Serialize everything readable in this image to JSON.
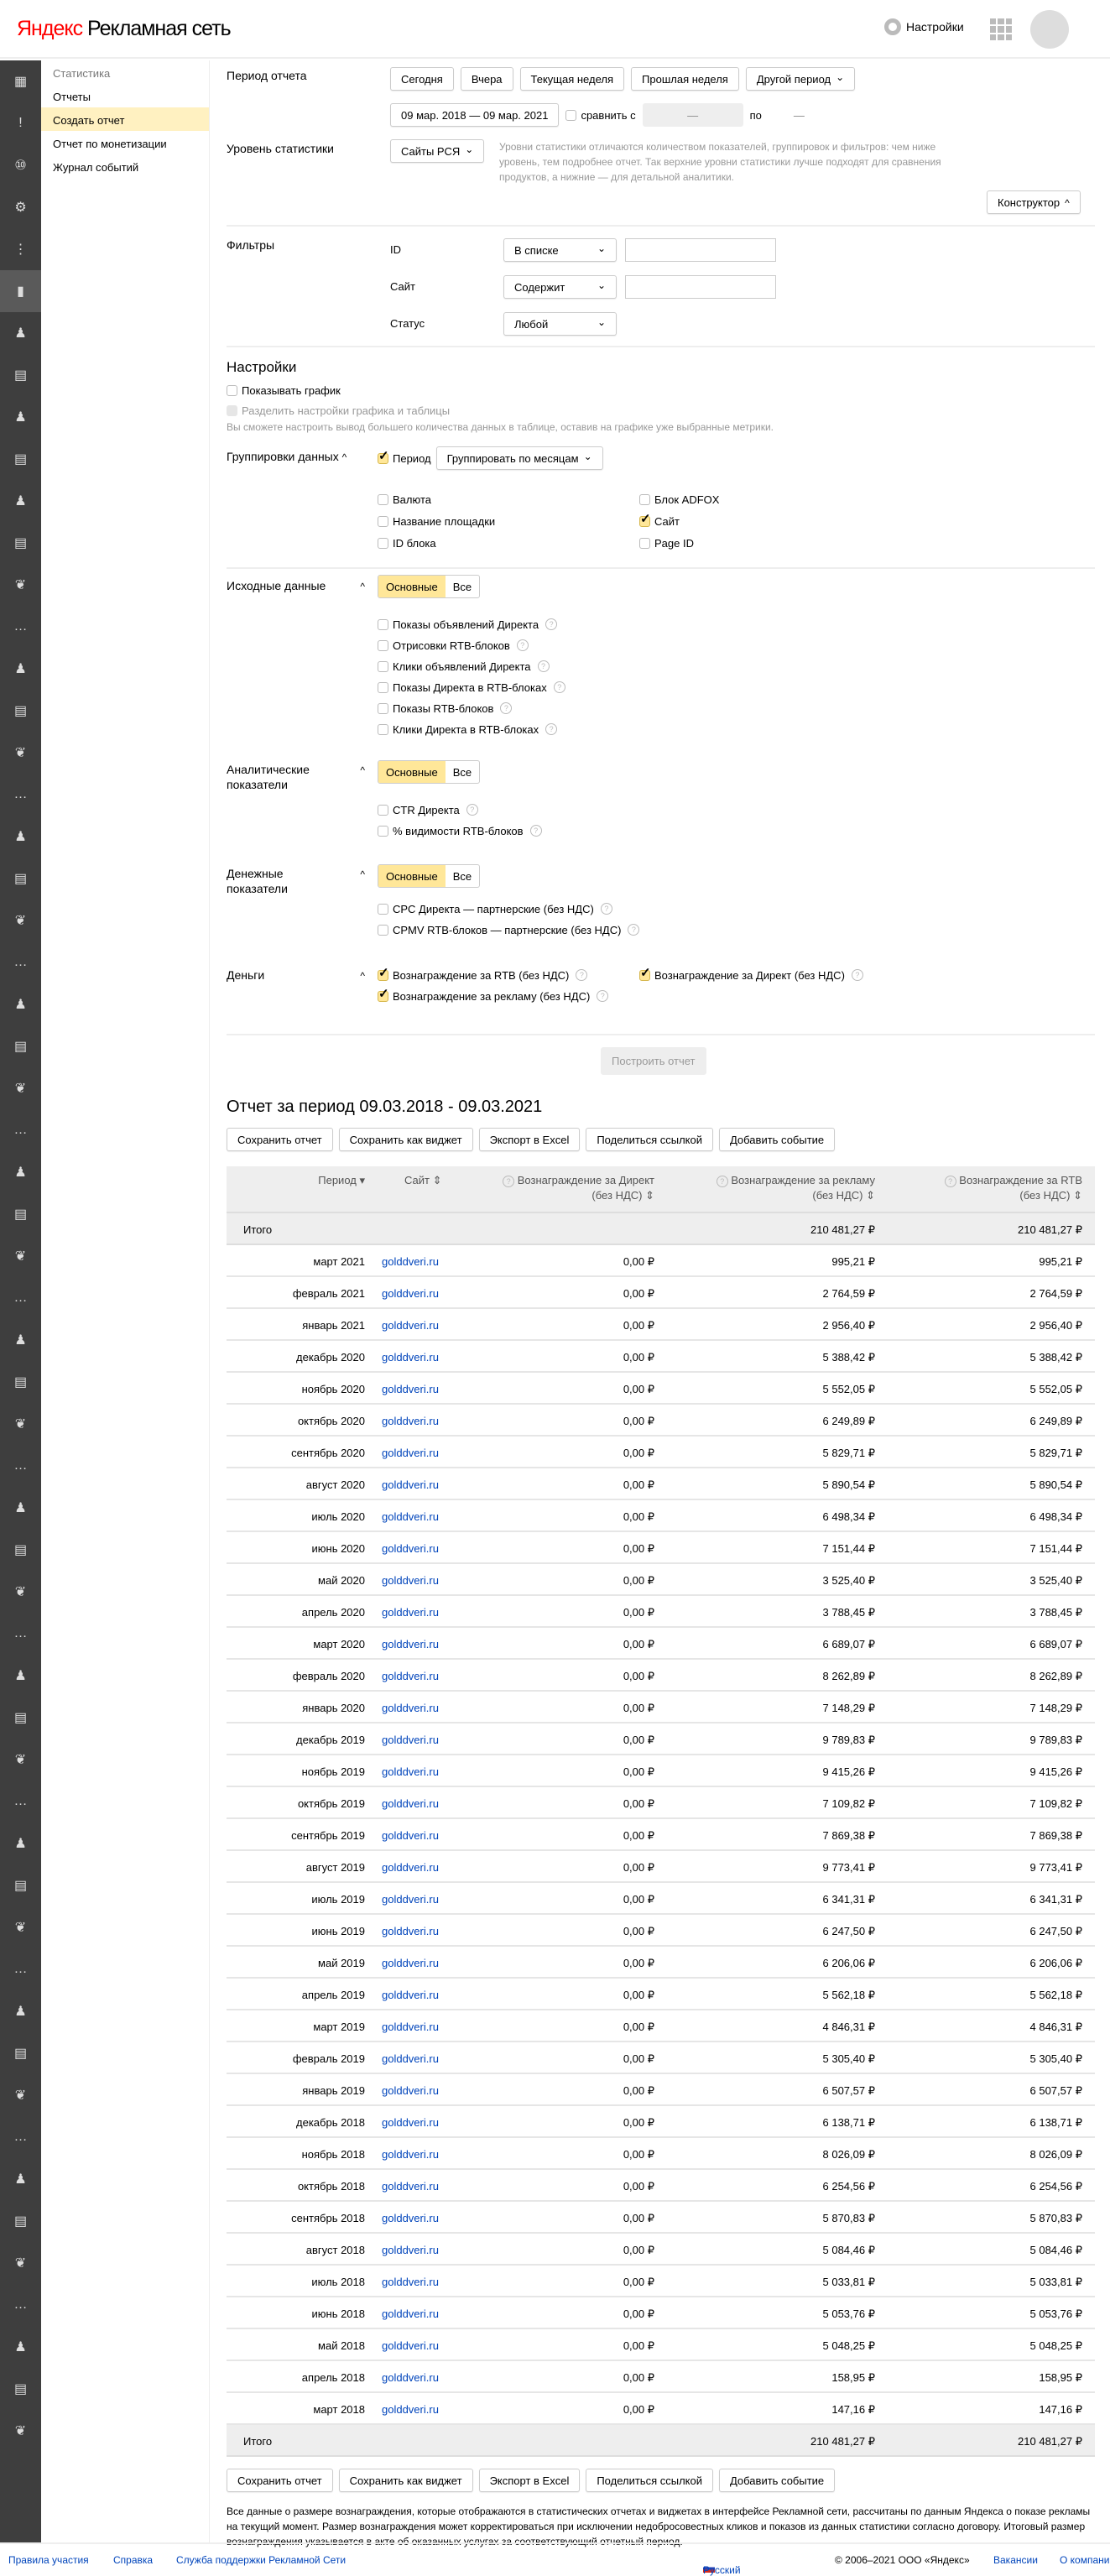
{
  "header": {
    "logo_brand": "Яндекс",
    "logo_product": "Рекламная сеть",
    "settings_label": "Настройки"
  },
  "iconbar": [
    "dashboard-icon",
    "bulb-icon",
    "badge-10-icon",
    "gear-icon",
    "split-icon",
    "chart-icon",
    "person-icon",
    "document-icon",
    "person-icon",
    "document-icon",
    "person-icon",
    "document-icon",
    "leaf-icon",
    "more-icon",
    "person-icon",
    "document-icon",
    "leaf-icon",
    "more-icon",
    "person-icon",
    "document-icon",
    "leaf-icon",
    "more-icon",
    "person-icon",
    "document-icon",
    "leaf-icon",
    "more-icon",
    "person-icon",
    "document-icon",
    "leaf-icon",
    "more-icon",
    "person-icon",
    "document-icon",
    "leaf-icon",
    "more-icon",
    "person-icon",
    "document-icon",
    "leaf-icon",
    "more-icon",
    "person-icon",
    "document-icon",
    "leaf-icon",
    "more-icon",
    "person-icon",
    "document-icon",
    "leaf-icon",
    "more-icon",
    "person-icon",
    "document-icon",
    "leaf-icon",
    "more-icon",
    "person-icon",
    "document-icon",
    "leaf-icon",
    "more-icon",
    "person-icon",
    "document-icon",
    "leaf-icon"
  ],
  "nav": {
    "title": "Статистика",
    "items": [
      "Отчеты",
      "Создать отчет",
      "Отчет по монетизации",
      "Журнал событий"
    ]
  },
  "period": {
    "label": "Период отчета",
    "buttons": [
      "Сегодня",
      "Вчера",
      "Текущая неделя",
      "Прошлая неделя"
    ],
    "other": "Другой период",
    "range": "09 мар. 2018 — 09 мар. 2021",
    "compare": "сравнить с",
    "compare_from": "—",
    "to": "по",
    "compare_to": "—"
  },
  "level": {
    "label": "Уровень статистики",
    "value": "Сайты РСЯ",
    "hint": "Уровни статистики отличаются количеством показателей, группировок и фильтров: чем ниже уровень, тем подробнее отчет. Так верхние уровни статистики лучше подходят для сравнения продуктов, а нижние — для детальной аналитики.",
    "constructor": "Конструктор"
  },
  "filters": {
    "label": "Фильтры",
    "rows": [
      {
        "name": "ID",
        "op": "В списке",
        "value": ""
      },
      {
        "name": "Сайт",
        "op": "Содержит",
        "value": ""
      },
      {
        "name": "Статус",
        "op": "Любой"
      }
    ]
  },
  "settings": {
    "title": "Настройки",
    "show_chart": "Показывать график",
    "split": "Разделить настройки графика и таблицы",
    "split_hint": "Вы сможете настроить вывод большего количества данных в таблице, оставив на графике уже выбранные метрики."
  },
  "grouping": {
    "label": "Группировки данных",
    "period": "Период",
    "period_group": "Группировать по месяцам",
    "left": [
      "Валюта",
      "Название площадки",
      "ID блока"
    ],
    "right": [
      "Блок ADFOX",
      "Сайт",
      "Page ID"
    ]
  },
  "seg": {
    "main": "Основные",
    "all": "Все"
  },
  "source": {
    "label": "Исходные данные",
    "items": [
      "Показы объявлений Директа",
      "Отрисовки RTB-блоков",
      "Клики объявлений Директа",
      "Показы Директа в RTB-блоках",
      "Показы RTB-блоков",
      "Клики Директа в RTB-блоках"
    ]
  },
  "analytics": {
    "label": "Аналитические показатели",
    "items": [
      "CTR Директа",
      "% видимости RTB-блоков"
    ]
  },
  "money_metrics": {
    "label": "Денежные показатели",
    "items": [
      "CPC Директа — партнерские (без НДС)",
      "CPMV RTB-блоков — партнерские (без НДС)"
    ]
  },
  "money": {
    "label": "Деньги",
    "items": [
      "Вознаграждение за RTB (без НДС)",
      "Вознаграждение за Директ (без НДС)",
      "Вознаграждение за рекламу (без НДС)"
    ]
  },
  "build": "Построить отчет",
  "report": {
    "title": "Отчет за период 09.03.2018 - 09.03.2021",
    "actions": [
      "Сохранить отчет",
      "Сохранить как виджет",
      "Экспорт в Excel",
      "Поделиться ссылкой",
      "Добавить событие"
    ]
  },
  "table": {
    "headers": {
      "period": "Период",
      "site": "Сайт",
      "direct_1": "Вознаграждение за Директ",
      "direct_2": "(без НДС)",
      "ad_1": "Вознаграждение за рекламу",
      "ad_2": "(без НДС)",
      "rtb_1": "Вознаграждение за RTB",
      "rtb_2": "(без НДС)"
    },
    "total": {
      "label": "Итого",
      "ad": "210 481,27 ₽",
      "rtb": "210 481,27 ₽"
    },
    "rows": [
      [
        "март 2021",
        "golddveri.ru",
        "0,00 ₽",
        "995,21 ₽",
        "995,21 ₽"
      ],
      [
        "февраль 2021",
        "golddveri.ru",
        "0,00 ₽",
        "2 764,59 ₽",
        "2 764,59 ₽"
      ],
      [
        "январь 2021",
        "golddveri.ru",
        "0,00 ₽",
        "2 956,40 ₽",
        "2 956,40 ₽"
      ],
      [
        "декабрь 2020",
        "golddveri.ru",
        "0,00 ₽",
        "5 388,42 ₽",
        "5 388,42 ₽"
      ],
      [
        "ноябрь 2020",
        "golddveri.ru",
        "0,00 ₽",
        "5 552,05 ₽",
        "5 552,05 ₽"
      ],
      [
        "октябрь 2020",
        "golddveri.ru",
        "0,00 ₽",
        "6 249,89 ₽",
        "6 249,89 ₽"
      ],
      [
        "сентябрь 2020",
        "golddveri.ru",
        "0,00 ₽",
        "5 829,71 ₽",
        "5 829,71 ₽"
      ],
      [
        "август 2020",
        "golddveri.ru",
        "0,00 ₽",
        "5 890,54 ₽",
        "5 890,54 ₽"
      ],
      [
        "июль 2020",
        "golddveri.ru",
        "0,00 ₽",
        "6 498,34 ₽",
        "6 498,34 ₽"
      ],
      [
        "июнь 2020",
        "golddveri.ru",
        "0,00 ₽",
        "7 151,44 ₽",
        "7 151,44 ₽"
      ],
      [
        "май 2020",
        "golddveri.ru",
        "0,00 ₽",
        "3 525,40 ₽",
        "3 525,40 ₽"
      ],
      [
        "апрель 2020",
        "golddveri.ru",
        "0,00 ₽",
        "3 788,45 ₽",
        "3 788,45 ₽"
      ],
      [
        "март 2020",
        "golddveri.ru",
        "0,00 ₽",
        "6 689,07 ₽",
        "6 689,07 ₽"
      ],
      [
        "февраль 2020",
        "golddveri.ru",
        "0,00 ₽",
        "8 262,89 ₽",
        "8 262,89 ₽"
      ],
      [
        "январь 2020",
        "golddveri.ru",
        "0,00 ₽",
        "7 148,29 ₽",
        "7 148,29 ₽"
      ],
      [
        "декабрь 2019",
        "golddveri.ru",
        "0,00 ₽",
        "9 789,83 ₽",
        "9 789,83 ₽"
      ],
      [
        "ноябрь 2019",
        "golddveri.ru",
        "0,00 ₽",
        "9 415,26 ₽",
        "9 415,26 ₽"
      ],
      [
        "октябрь 2019",
        "golddveri.ru",
        "0,00 ₽",
        "7 109,82 ₽",
        "7 109,82 ₽"
      ],
      [
        "сентябрь 2019",
        "golddveri.ru",
        "0,00 ₽",
        "7 869,38 ₽",
        "7 869,38 ₽"
      ],
      [
        "август 2019",
        "golddveri.ru",
        "0,00 ₽",
        "9 773,41 ₽",
        "9 773,41 ₽"
      ],
      [
        "июль 2019",
        "golddveri.ru",
        "0,00 ₽",
        "6 341,31 ₽",
        "6 341,31 ₽"
      ],
      [
        "июнь 2019",
        "golddveri.ru",
        "0,00 ₽",
        "6 247,50 ₽",
        "6 247,50 ₽"
      ],
      [
        "май 2019",
        "golddveri.ru",
        "0,00 ₽",
        "6 206,06 ₽",
        "6 206,06 ₽"
      ],
      [
        "апрель 2019",
        "golddveri.ru",
        "0,00 ₽",
        "5 562,18 ₽",
        "5 562,18 ₽"
      ],
      [
        "март 2019",
        "golddveri.ru",
        "0,00 ₽",
        "4 846,31 ₽",
        "4 846,31 ₽"
      ],
      [
        "февраль 2019",
        "golddveri.ru",
        "0,00 ₽",
        "5 305,40 ₽",
        "5 305,40 ₽"
      ],
      [
        "январь 2019",
        "golddveri.ru",
        "0,00 ₽",
        "6 507,57 ₽",
        "6 507,57 ₽"
      ],
      [
        "декабрь 2018",
        "golddveri.ru",
        "0,00 ₽",
        "6 138,71 ₽",
        "6 138,71 ₽"
      ],
      [
        "ноябрь 2018",
        "golddveri.ru",
        "0,00 ₽",
        "8 026,09 ₽",
        "8 026,09 ₽"
      ],
      [
        "октябрь 2018",
        "golddveri.ru",
        "0,00 ₽",
        "6 254,56 ₽",
        "6 254,56 ₽"
      ],
      [
        "сентябрь 2018",
        "golddveri.ru",
        "0,00 ₽",
        "5 870,83 ₽",
        "5 870,83 ₽"
      ],
      [
        "август 2018",
        "golddveri.ru",
        "0,00 ₽",
        "5 084,46 ₽",
        "5 084,46 ₽"
      ],
      [
        "июль 2018",
        "golddveri.ru",
        "0,00 ₽",
        "5 033,81 ₽",
        "5 033,81 ₽"
      ],
      [
        "июнь 2018",
        "golddveri.ru",
        "0,00 ₽",
        "5 053,76 ₽",
        "5 053,76 ₽"
      ],
      [
        "май 2018",
        "golddveri.ru",
        "0,00 ₽",
        "5 048,25 ₽",
        "5 048,25 ₽"
      ],
      [
        "апрель 2018",
        "golddveri.ru",
        "0,00 ₽",
        "158,95 ₽",
        "158,95 ₽"
      ],
      [
        "март 2018",
        "golddveri.ru",
        "0,00 ₽",
        "147,16 ₽",
        "147,16 ₽"
      ]
    ]
  },
  "disclaimer": "Все данные о размере вознаграждения, которые отображаются в статистических отчетах и виджетах в интерфейсе Рекламной сети, рассчитаны по данным Яндекса о показе рекламы на текущий момент. Размер вознаграждения может корректироваться при исключении недобросовестных кликов и показов из данных статистики согласно договору. Итоговый размер вознаграждения указывается в акте об оказанных услугах за соответствующий отчетный период.",
  "footer": {
    "rules": "Правила участия",
    "help": "Справка",
    "support": "Служба поддержки Рекламной Сети",
    "lang": "Русский",
    "copyright": "© 2006–2021 ООО «Яндекс»",
    "jobs": "Вакансии",
    "about": "О компании"
  }
}
